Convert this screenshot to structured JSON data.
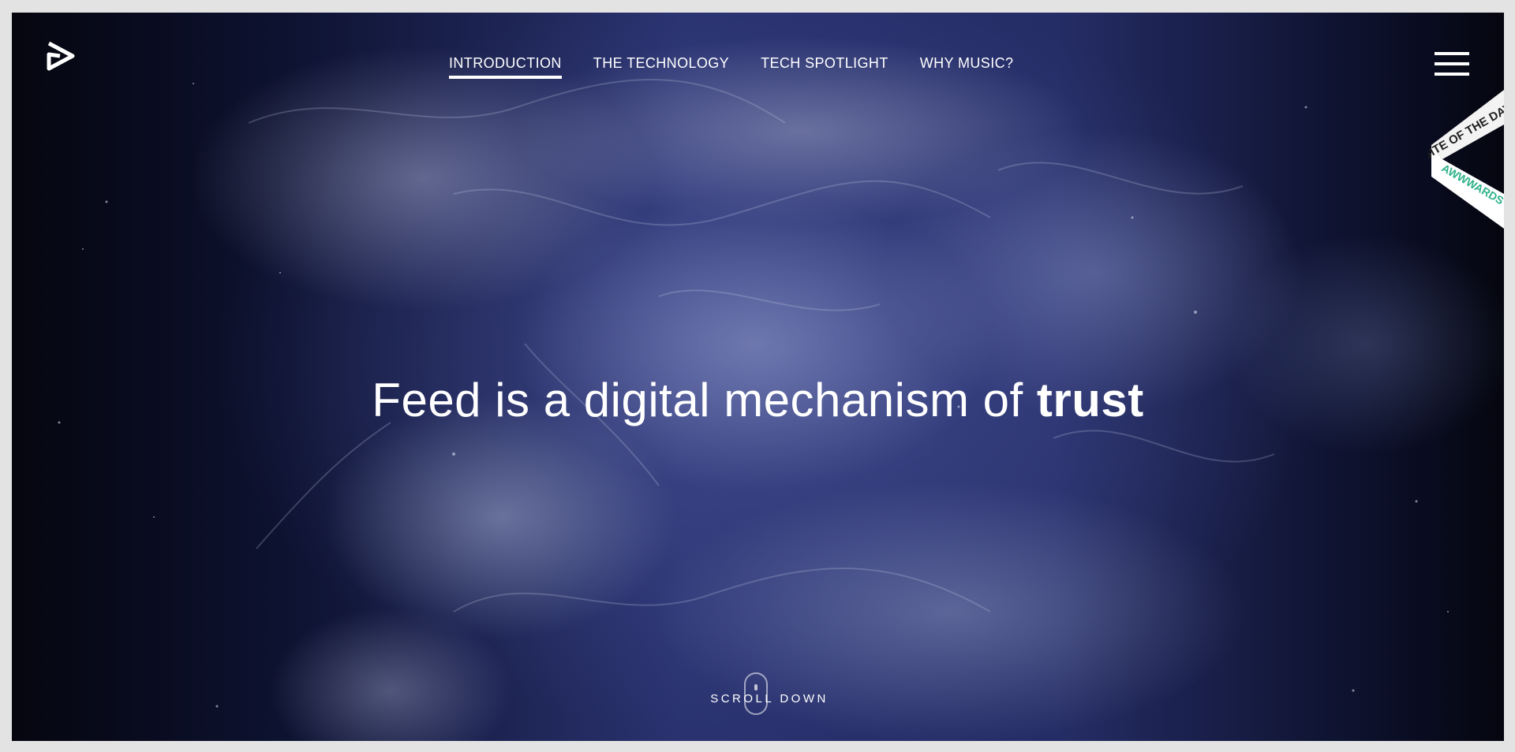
{
  "nav": {
    "items": [
      {
        "label": "INTRODUCTION",
        "active": true
      },
      {
        "label": "THE TECHNOLOGY",
        "active": false
      },
      {
        "label": "TECH SPOTLIGHT",
        "active": false
      },
      {
        "label": "WHY MUSIC?",
        "active": false
      }
    ]
  },
  "hero": {
    "headline_prefix": "Feed is a digital mechanism of ",
    "headline_emphasis": "trust"
  },
  "scroll": {
    "label": "SCROLL DOWN"
  },
  "award": {
    "line1": "SITE OF THE DAY",
    "line2": "AWWWARDS"
  },
  "icons": {
    "logo": "play-triangle-logo-icon",
    "menu": "hamburger-menu-icon",
    "scroll": "mouse-scroll-icon"
  },
  "colors": {
    "text": "#ffffff",
    "accent_green": "#2fb28a",
    "background_deep": "#0a0d1f",
    "background_glow": "#2a3370"
  }
}
